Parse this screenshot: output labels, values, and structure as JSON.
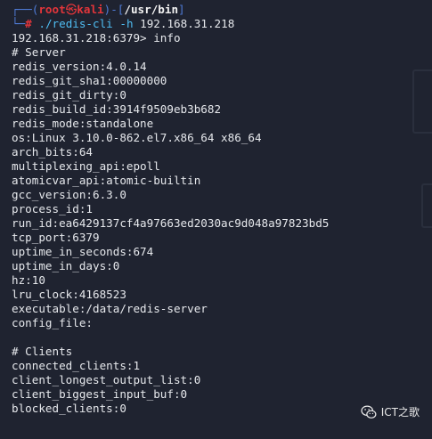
{
  "prompt": {
    "corner_top": "┌──(",
    "user": "root",
    "at_symbol": "㉿",
    "host": "kali",
    "sep": ")-[",
    "path": "/usr/bin",
    "close": "]",
    "corner_bottom": "└─",
    "hash": "#",
    "command": "./redis-cli",
    "flag": "-h",
    "arg": "192.168.31.218"
  },
  "redis_prompt": "192.168.31.218:6379> info",
  "output_lines": [
    "# Server",
    "redis_version:4.0.14",
    "redis_git_sha1:00000000",
    "redis_git_dirty:0",
    "redis_build_id:3914f9509eb3b682",
    "redis_mode:standalone",
    "os:Linux 3.10.0-862.el7.x86_64 x86_64",
    "arch_bits:64",
    "multiplexing_api:epoll",
    "atomicvar_api:atomic-builtin",
    "gcc_version:6.3.0",
    "process_id:1",
    "run_id:ea6429137cf4a97663ed2030ac9d048a97823bd5",
    "tcp_port:6379",
    "uptime_in_seconds:674",
    "uptime_in_days:0",
    "hz:10",
    "lru_clock:4168523",
    "executable:/data/redis-server",
    "config_file:",
    "",
    "# Clients",
    "connected_clients:1",
    "client_longest_output_list:0",
    "client_biggest_input_buf:0",
    "blocked_clients:0"
  ],
  "watermark": {
    "icon": "wechat-icon",
    "text": "ICT之歌"
  }
}
